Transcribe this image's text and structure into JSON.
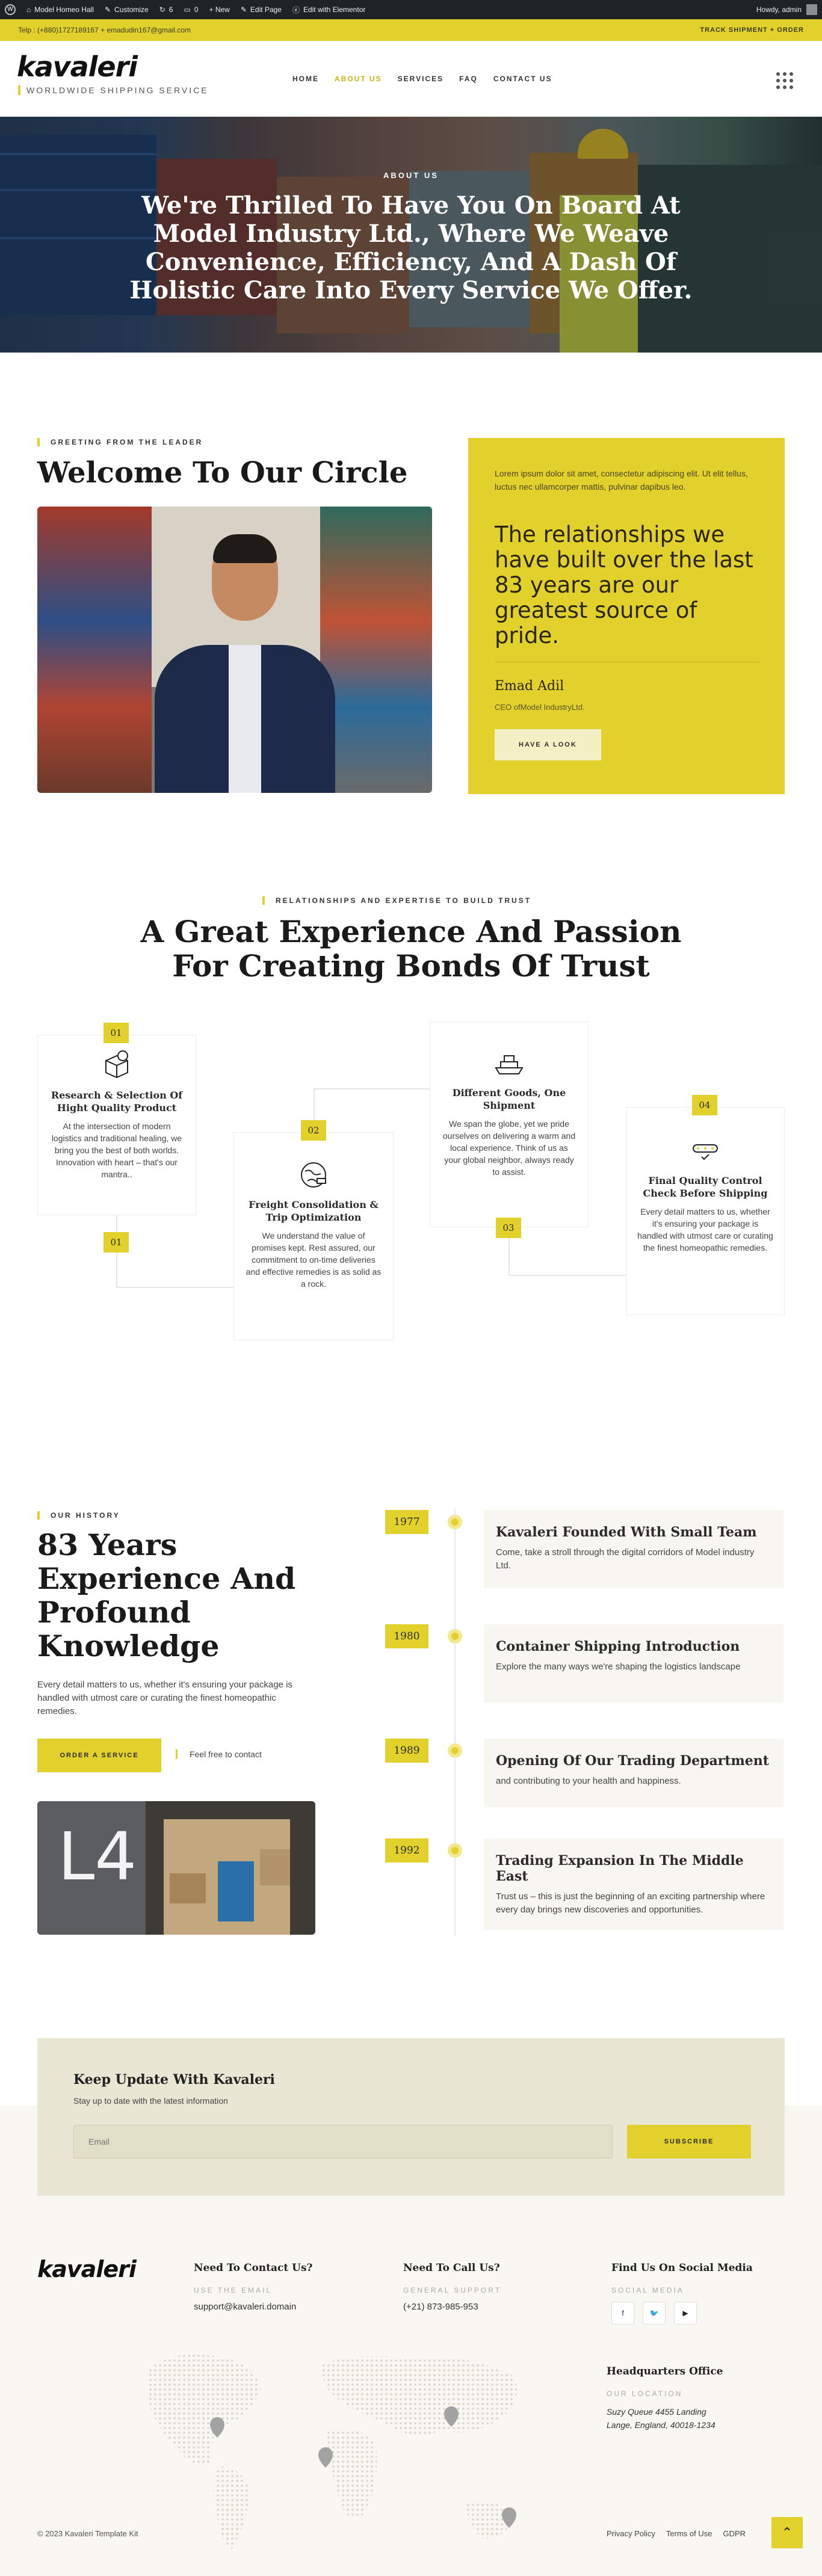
{
  "admin_bar": {
    "wp_logo": "W",
    "site_name": "Model Homeo Hall",
    "customize": "Customize",
    "updates": "6",
    "comments": "0",
    "new": "+ New",
    "edit_page": "Edit Page",
    "elementor": "Edit with Elementor",
    "howdy": "Howdy, admin"
  },
  "topbar": {
    "contact": "Telp : (+880)1727189167 + emadudin167@gmail.com",
    "links": "TRACK SHIPMENT + ORDER"
  },
  "header": {
    "logo": "kavaleri",
    "tagline": "WORLDWIDE SHIPPING SERVICE",
    "nav": [
      "HOME",
      "ABOUT US",
      "SERVICES",
      "FAQ",
      "CONTACT US"
    ]
  },
  "hero": {
    "eyebrow": "ABOUT US",
    "title": "We're Thrilled To Have You On Board At Model Industry Ltd., Where We Weave Convenience, Efficiency, And A Dash Of Holistic Care Into Every Service We Offer."
  },
  "greeting": {
    "eyebrow": "GREETING FROM THE LEADER",
    "title": "Welcome To Our Circle",
    "intro": "Lorem ipsum dolor sit amet, consectetur adipiscing elit. Ut elit tellus, luctus nec ullamcorper mattis, pulvinar dapibus leo.",
    "quote": "The relationships we have built over the last 83 years are our greatest source of pride.",
    "name": "Emad Adil",
    "role": "CEO ofModel IndustryLtd.",
    "button": "HAVE A LOOK"
  },
  "trust": {
    "eyebrow": "RELATIONSHIPS AND EXPERTISE TO BUILD TRUST",
    "title": "A Great Experience And Passion For Creating Bonds Of Trust",
    "steps": [
      {
        "num": "01",
        "title": "Research & Selection Of Hight Quality Product",
        "desc": "At the intersection of modern logistics and traditional healing, we bring you the best of both worlds. Innovation with heart – that's our mantra..",
        "num2": "01"
      },
      {
        "num": "02",
        "title": "Freight Consolidation & Trip Optimization",
        "desc": "We understand the value of promises kept. Rest assured, our commitment to on-time deliveries and effective remedies is as solid as a rock."
      },
      {
        "num": "03",
        "title": "Different Goods, One Shipment",
        "desc": "We span the globe, yet we pride ourselves on delivering a warm and local experience. Think of us as your global neighbor, always ready to assist."
      },
      {
        "num": "04",
        "title": "Final Quality Control Check Before Shipping",
        "desc": "Every detail matters to us, whether it's ensuring your package is handled with utmost care or curating the finest homeopathic remedies."
      }
    ]
  },
  "history": {
    "eyebrow": "OUR HISTORY",
    "title": "83 Years Experience And Profound Knowledge",
    "desc": " Every detail matters to us, whether it's ensuring your package is handled with utmost care or curating the finest homeopathic remedies.",
    "button": "ORDER A SERVICE",
    "contact_note": "Feel free to contact",
    "photo_sign": "L4",
    "timeline": [
      {
        "year": "1977",
        "title": "Kavaleri Founded With Small Team",
        "desc": "Come, take a stroll through the digital corridors of Model industry Ltd."
      },
      {
        "year": "1980",
        "title": "Container Shipping Introduction",
        "desc": "Explore the many ways we're shaping the logistics landscape"
      },
      {
        "year": "1989",
        "title": "Opening Of Our Trading Department",
        "desc": "and contributing to your health and happiness."
      },
      {
        "year": "1992",
        "title": "Trading Expansion In The Middle East",
        "desc": "Trust us – this is just the beginning of an exciting partnership where every day brings new discoveries and opportunities."
      }
    ]
  },
  "newsletter": {
    "title": "Keep Update With Kavaleri",
    "subtitle": "Stay up to date with the latest information",
    "placeholder": "Email",
    "button": "SUBSCRIBE"
  },
  "footer": {
    "logo": "kavaleri",
    "col1": {
      "heading": "Need To Contact Us?",
      "label": "USE THE EMAIL",
      "value": "support@kavaleri.domain"
    },
    "col2": {
      "heading": "Need To Call Us?",
      "label": "GENERAL SUPPORT",
      "value": "(+21) 873-985-953"
    },
    "col3": {
      "heading": "Find Us On Social Media",
      "label": "SOCIAL MEDIA",
      "icons": [
        "facebook-icon",
        "twitter-icon",
        "youtube-icon"
      ],
      "hq_heading": "Headquarters Office",
      "hq_label": "OUR LOCATION",
      "hq_value": "Suzy Queue 4455 Landing Lange, England, 40018-1234"
    },
    "copyright": "© 2023 Kavaleri Template Kit",
    "links": [
      "Privacy Policy",
      "Terms of Use",
      "GDPR"
    ]
  },
  "colors": {
    "accent": "#e2d12c",
    "dark": "#1d2327",
    "cream": "#e9e6d3"
  }
}
